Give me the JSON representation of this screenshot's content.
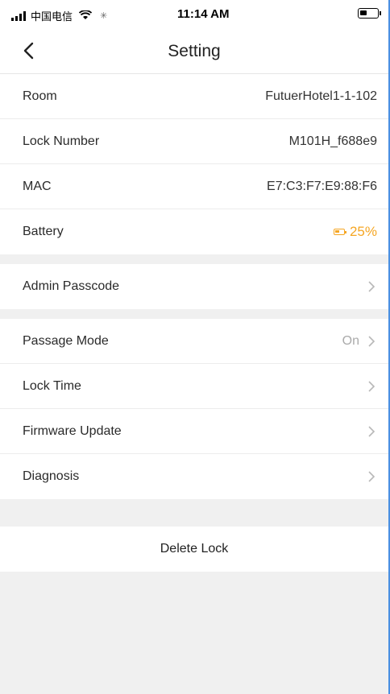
{
  "status_bar": {
    "carrier": "中国电信",
    "time": "11:14 AM"
  },
  "nav": {
    "title": "Setting"
  },
  "info_rows": [
    {
      "label": "Room",
      "value": "FutuerHotel1-1-102"
    },
    {
      "label": "Lock Number",
      "value": "M101H_f688e9"
    },
    {
      "label": "MAC",
      "value": "E7:C3:F7:E9:88:F6"
    },
    {
      "label": "Battery",
      "value": "25%"
    }
  ],
  "admin_row": {
    "label": "Admin Passcode"
  },
  "settings_rows": [
    {
      "label": "Passage Mode",
      "value": "On"
    },
    {
      "label": "Lock Time",
      "value": ""
    },
    {
      "label": "Firmware Update",
      "value": ""
    },
    {
      "label": "Diagnosis",
      "value": ""
    }
  ],
  "delete_label": "Delete Lock",
  "colors": {
    "battery_accent": "#f5a623",
    "background": "#f0f0f0"
  }
}
